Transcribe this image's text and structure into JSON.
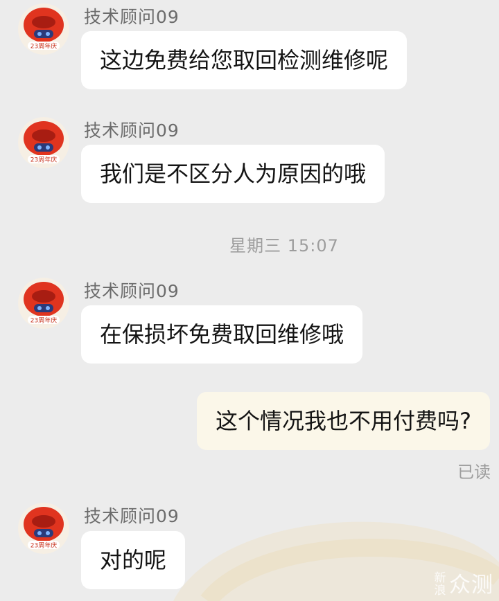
{
  "agent_name": "技术顾问09",
  "avatar_badge": "23周年庆",
  "messages": [
    {
      "sender": "技术顾问09",
      "text": "这边免费给您取回检测维修呢"
    },
    {
      "sender": "技术顾问09",
      "text": "我们是不区分人为原因的哦"
    },
    {
      "sender": "技术顾问09",
      "text": "在保损坏免费取回维修哦"
    },
    {
      "text": "这个情况我也不用付费吗?"
    },
    {
      "sender": "技术顾问09",
      "text": "对的呢"
    }
  ],
  "timestamp": "星期三 15:07",
  "read_status": "已读",
  "watermark": {
    "badge": "新浪",
    "text": "众测"
  },
  "colors": {
    "background": "#ececec",
    "bubble_in": "#ffffff",
    "bubble_out": "#fbf7e9",
    "avatar_red": "#e0341f"
  }
}
